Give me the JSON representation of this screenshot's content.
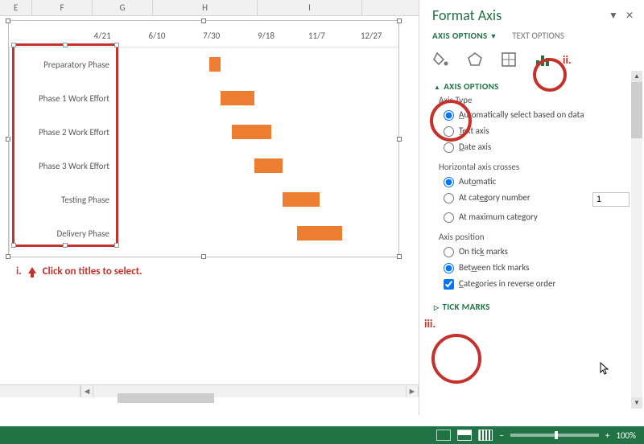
{
  "columns": [
    "E",
    "F",
    "G",
    "H",
    "I"
  ],
  "chart_data": {
    "type": "bar",
    "categories": [
      "Preparatory Phase",
      "Phase 1 Work Effort",
      "Phase 2 Work Effort",
      "Phase 3 Work Effort",
      "Testing Phase",
      "Delivery Phase"
    ],
    "x_ticks": [
      "4/21",
      "6/10",
      "7/30",
      "9/18",
      "11/7",
      "12/27"
    ],
    "bars": [
      {
        "left_pct": 33,
        "width_pct": 4
      },
      {
        "left_pct": 37,
        "width_pct": 12
      },
      {
        "left_pct": 41,
        "width_pct": 14
      },
      {
        "left_pct": 49,
        "width_pct": 10
      },
      {
        "left_pct": 59,
        "width_pct": 13
      },
      {
        "left_pct": 64,
        "width_pct": 16
      }
    ]
  },
  "annot": {
    "i_prefix": "i.",
    "i_text": "Click on titles to select.",
    "ii": "ii.",
    "iii": "iii."
  },
  "pane": {
    "title": "Format Axis",
    "tab_axis_options": "AXIS OPTIONS",
    "tab_text_options": "TEXT OPTIONS",
    "section_axis_options": "AXIS OPTIONS",
    "axis_type_label": "Axis Type",
    "opt_auto": "Automatically select based on data",
    "opt_text": "Text axis",
    "opt_date": "Date axis",
    "h_crosses_label": "Horizontal axis crosses",
    "opt_automatic": "Automatic",
    "opt_at_cat_num": "At category number",
    "cat_num_value": "1",
    "opt_at_max": "At maximum category",
    "axis_position_label": "Axis position",
    "opt_on_tick": "On tick marks",
    "opt_between_tick": "Between tick marks",
    "opt_reverse": "Categories in reverse order",
    "section_tick": "TICK MARKS"
  },
  "status": {
    "minus": "−",
    "plus": "+",
    "zoom": "100%"
  }
}
